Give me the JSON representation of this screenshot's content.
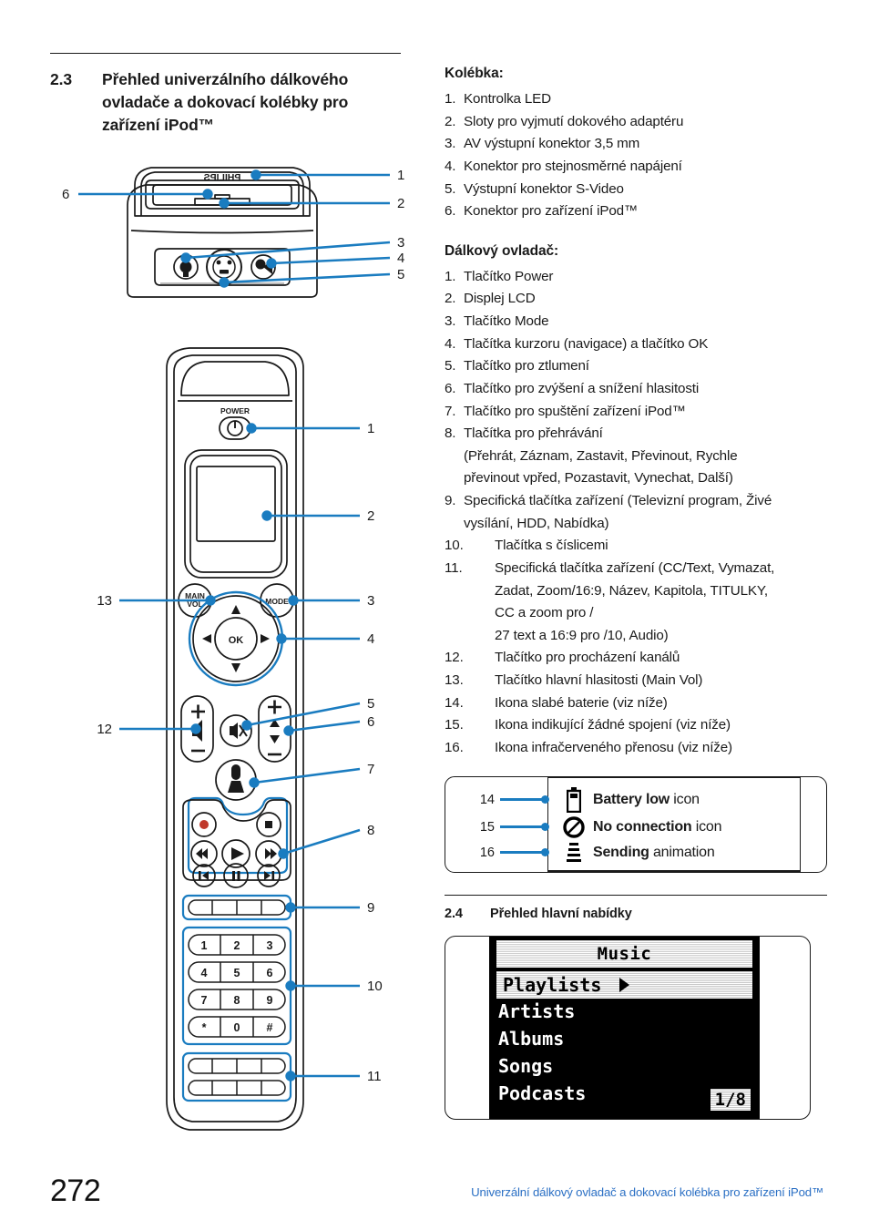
{
  "page": {
    "number": "272",
    "footer_note": "Univerzální dálkový ovladač a dokovací kolébka pro zařízení iPod™",
    "accent_blue": "#1a7cc0",
    "footer_blue": "#2a6fc4",
    "ink": "#1a1a1a"
  },
  "section_23": {
    "number": "2.3",
    "title": "Přehled univerzálního dálkového ovladače a dokovací kolébky pro zařízení iPod™"
  },
  "section_24": {
    "number": "2.4",
    "title": "Přehled hlavní nabídky"
  },
  "dock": {
    "heading": "Kolébka:",
    "brand": "PHILIPS",
    "items": [
      {
        "n": "1.",
        "text": "Kontrolka LED"
      },
      {
        "n": "2.",
        "text": "Sloty pro vyjmutí dokového adaptéru"
      },
      {
        "n": "3.",
        "text": "AV výstupní konektor 3,5 mm"
      },
      {
        "n": "4.",
        "text": "Konektor pro stejnosměrné napájení"
      },
      {
        "n": "5.",
        "text": "Výstupní konektor S-Video"
      },
      {
        "n": "6.",
        "text": "Konektor pro zařízení iPod™"
      }
    ],
    "callouts": [
      "1",
      "2",
      "3",
      "4",
      "5",
      "6"
    ]
  },
  "remote": {
    "heading": "Dálkový ovladač:",
    "items": [
      {
        "n": "1.",
        "text": "Tlačítko Power",
        "sub": ""
      },
      {
        "n": "2.",
        "text": "Displej LCD",
        "sub": ""
      },
      {
        "n": "3.",
        "text": "Tlačítko Mode",
        "sub": ""
      },
      {
        "n": "4.",
        "text": "Tlačítka kurzoru (navigace) a tlačítko OK",
        "sub": ""
      },
      {
        "n": "5.",
        "text": "Tlačítko pro ztlumení",
        "sub": ""
      },
      {
        "n": "6.",
        "text": "Tlačítko pro zvýšení a snížení hlasitosti",
        "sub": ""
      },
      {
        "n": "7.",
        "text": "Tlačítko pro spuštění zařízení iPod™",
        "sub": ""
      },
      {
        "n": "8.",
        "text": "Tlačítka pro přehrávání",
        "sub": "(Přehrát, Záznam, Zastavit, Převinout, Rychle",
        "sub2": "převinout vpřed, Pozastavit, Vynechat, Další)"
      },
      {
        "n": "9.",
        "text": "Specifická tlačítka zařízení (Televizní program, Živé",
        "sub": "vysílání, HDD, Nabídka)"
      }
    ],
    "items_wide": [
      {
        "n": "10.",
        "text": "Tlačítka s číslicemi",
        "sub": ""
      },
      {
        "n": "11.",
        "text": "Specifická tlačítka zařízení (CC/Text, Vymazat,",
        "sub": "Zadat, Zoom/16:9, Název, Kapitola, TITULKY,",
        "sub2": "CC a zoom pro /",
        "sub3": "27 text a 16:9 pro /10, Audio)"
      },
      {
        "n": "12.",
        "text": "Tlačítko pro procházení kanálů",
        "sub": ""
      },
      {
        "n": "13.",
        "text": "Tlačítko hlavní hlasitosti (Main Vol)",
        "sub": ""
      },
      {
        "n": "14.",
        "text": "Ikona slabé baterie (viz níže)",
        "sub": ""
      },
      {
        "n": "15.",
        "text": "Ikona indikující žádné spojení (viz níže)",
        "sub": ""
      },
      {
        "n": "16.",
        "text": "Ikona infračerveného přenosu (viz níže)",
        "sub": ""
      }
    ],
    "callouts_right": [
      "1",
      "2",
      "3",
      "4",
      "5",
      "6",
      "7",
      "8",
      "9",
      "10",
      "11"
    ],
    "callouts_left": [
      "13",
      "12"
    ],
    "labels": {
      "power": "POWER",
      "main_vol_line1": "MAIN",
      "main_vol_line2": "VOL",
      "mode": "MODE",
      "ok": "OK"
    },
    "keypad": [
      [
        "1",
        "2",
        "3"
      ],
      [
        "4",
        "5",
        "6"
      ],
      [
        "7",
        "8",
        "9"
      ],
      [
        "*",
        "0",
        "#"
      ]
    ]
  },
  "icon_legend": {
    "rows": [
      {
        "n": "14",
        "icon": "battery-low-icon",
        "bold": "Battery low",
        "rest": " icon"
      },
      {
        "n": "15",
        "icon": "no-connection-icon",
        "bold": "No connection",
        "rest": " icon"
      },
      {
        "n": "16",
        "icon": "sending-icon",
        "bold": "Sending",
        "rest": " animation"
      }
    ]
  },
  "ipod_menu": {
    "header": "Music",
    "selected": "Playlists",
    "items": [
      "Artists",
      "Albums",
      "Songs",
      "Podcasts"
    ],
    "page_indicator": "1/8"
  }
}
